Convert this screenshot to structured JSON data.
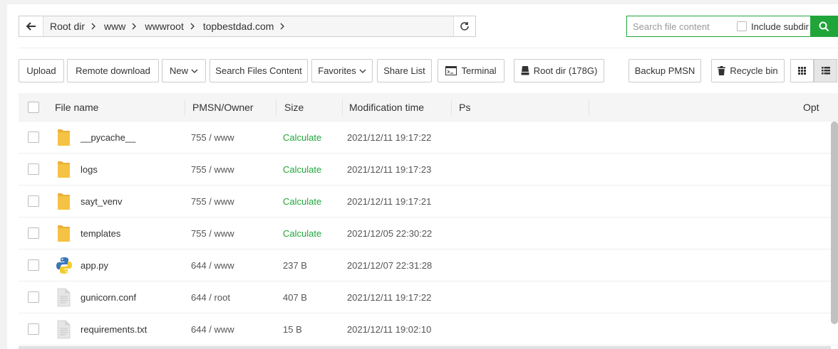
{
  "path": {
    "crumbs": [
      "Root dir",
      "www",
      "wwwroot",
      "topbestdad.com"
    ]
  },
  "search": {
    "placeholder": "Search file content",
    "include_subdir_label": "Include subdir"
  },
  "toolbar": {
    "upload": "Upload",
    "remote_download": "Remote download",
    "new": "New",
    "search_files_content": "Search Files Content",
    "favorites": "Favorites",
    "share_list": "Share List",
    "terminal": "Terminal",
    "root_dir": "Root dir (178G)",
    "backup_pmsn": "Backup PMSN",
    "recycle_bin": "Recycle bin"
  },
  "table": {
    "headers": {
      "file_name": "File name",
      "pmsn_owner": "PMSN/Owner",
      "size": "Size",
      "mtime": "Modification time",
      "ps": "Ps",
      "opt": "Opt"
    },
    "rows": [
      {
        "name": "__pycache__",
        "icon": "folder-icon",
        "perm": "755 / www",
        "size": "Calculate",
        "mtime": "2021/12/11 19:17:22"
      },
      {
        "name": "logs",
        "icon": "folder-icon",
        "perm": "755 / www",
        "size": "Calculate",
        "mtime": "2021/12/11 19:17:23"
      },
      {
        "name": "sayt_venv",
        "icon": "folder-icon",
        "perm": "755 / www",
        "size": "Calculate",
        "mtime": "2021/12/11 19:17:21"
      },
      {
        "name": "templates",
        "icon": "folder-icon",
        "perm": "755 / www",
        "size": "Calculate",
        "mtime": "2021/12/05 22:30:22"
      },
      {
        "name": "app.py",
        "icon": "python-file-icon",
        "perm": "644 / www",
        "size": "237 B",
        "mtime": "2021/12/07 22:31:28"
      },
      {
        "name": "gunicorn.conf",
        "icon": "text-file-icon",
        "perm": "644 / root",
        "size": "407 B",
        "mtime": "2021/12/11 19:17:22"
      },
      {
        "name": "requirements.txt",
        "icon": "text-file-icon",
        "perm": "644 / www",
        "size": "15 B",
        "mtime": "2021/12/11 19:02:10"
      }
    ]
  },
  "colors": {
    "accent": "#20a53a",
    "folder": "#f5c244"
  }
}
